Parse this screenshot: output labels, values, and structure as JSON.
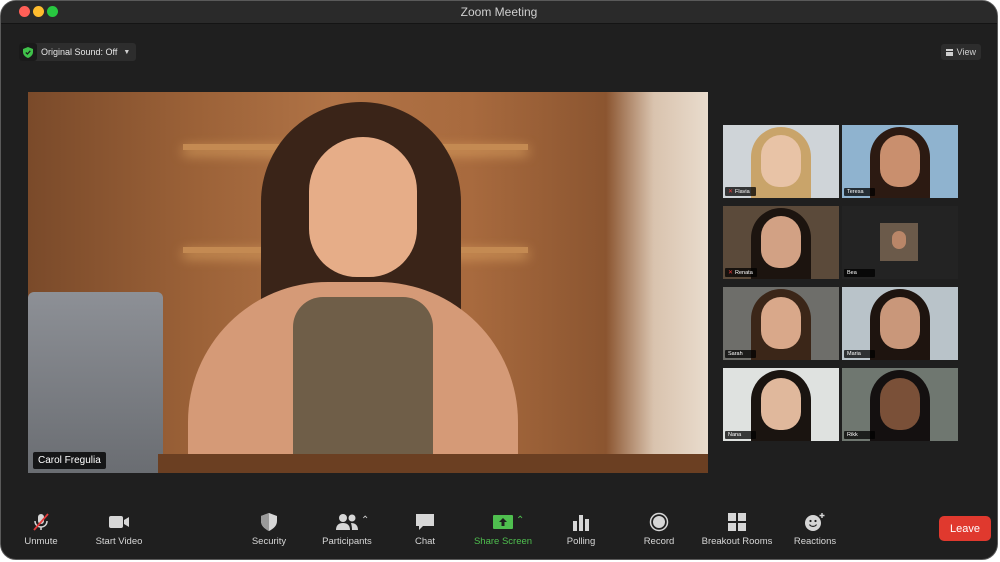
{
  "window": {
    "title": "Zoom Meeting"
  },
  "top_bar": {
    "original_sound_label": "Original Sound: Off",
    "view_label": "View"
  },
  "main_video": {
    "speaker_name": "Carol Fregulia"
  },
  "gallery": [
    {
      "name": "Flavia",
      "muted": true,
      "hair": "#c9a46a",
      "skin": "#e8c3a6",
      "bg": "#cfd4d8"
    },
    {
      "name": "Teresa",
      "muted": false,
      "hair": "#2c1a12",
      "skin": "#c98f6e",
      "bg": "#8fb3cf"
    },
    {
      "name": "Renata",
      "muted": true,
      "hair": "#1c140f",
      "skin": "#d2a184",
      "bg": "#5b4a3a"
    },
    {
      "name": "Bea",
      "muted": false,
      "hair": "#2a1c14",
      "skin": "#b98668",
      "bg": "#232323"
    },
    {
      "name": "Sarah",
      "muted": false,
      "hair": "#3b2618",
      "skin": "#d9a88a",
      "bg": "#6e6e6a"
    },
    {
      "name": "Maria",
      "muted": false,
      "hair": "#1e140f",
      "skin": "#c9977a",
      "bg": "#b9c3c9"
    },
    {
      "name": "Nana",
      "muted": false,
      "hair": "#1a1410",
      "skin": "#e0b89c",
      "bg": "#dfe2e0"
    },
    {
      "name": "Rikk",
      "muted": false,
      "hair": "#141010",
      "skin": "#7a5038",
      "bg": "#6f7770"
    }
  ],
  "toolbar": {
    "unmute": "Unmute",
    "start_video": "Start Video",
    "security": "Security",
    "participants": "Participants",
    "chat": "Chat",
    "share_screen": "Share Screen",
    "polling": "Polling",
    "record": "Record",
    "breakout_rooms": "Breakout Rooms",
    "reactions": "Reactions",
    "leave": "Leave"
  },
  "colors": {
    "window_bg": "#1f1f1f",
    "share_green": "#4fbf4f",
    "leave_red": "#e0392e",
    "mute_red": "#e23b3b"
  }
}
